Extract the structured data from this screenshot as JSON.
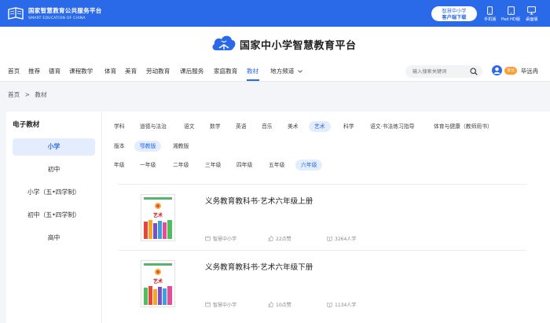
{
  "topbar": {
    "brand_cn": "国家智慧教育公共服务平台",
    "brand_en": "SMART EDUCATION OF CHINA",
    "download_line1": "智慧中小学",
    "download_line2": "客户端下载",
    "devices": [
      "手机版",
      "Pad HD版",
      "桌面版"
    ]
  },
  "header": {
    "title": "国家中小学智慧教育平台"
  },
  "nav": {
    "items": [
      "首页",
      "推荐",
      "德育",
      "课程教学",
      "体育",
      "美育",
      "劳动教育",
      "课后服务",
      "家庭教育",
      "教材",
      "地方频道"
    ],
    "active_index": 9,
    "search_placeholder": "输入搜索关键词",
    "role_badge": "家长",
    "user_name": "毕远冉"
  },
  "breadcrumb": {
    "home": "首页",
    "sep": ">",
    "current": "教材"
  },
  "sidebar": {
    "title": "电子教材",
    "items": [
      "小学",
      "初中",
      "小学（五•四学制）",
      "初中（五•四学制）",
      "高中"
    ],
    "active_index": 0
  },
  "filters": {
    "subject_label": "学科",
    "subjects": [
      "道德与法治",
      "语文",
      "数学",
      "英语",
      "音乐",
      "美术",
      "艺术",
      "科学",
      "语文·书法练习指导",
      "体育与健康（教师用书）"
    ],
    "subject_active": 6,
    "edition_label": "版本",
    "editions": [
      "鄂教版",
      "湘教版"
    ],
    "edition_active": 0,
    "grade_label": "年级",
    "grades": [
      "一年级",
      "二年级",
      "三年级",
      "四年级",
      "五年级",
      "六年级"
    ],
    "grade_active": 5
  },
  "books": [
    {
      "title": "义务教育教科书·艺术六年级上册",
      "cover_title": "艺术",
      "publisher": "智慧中小学",
      "likes": "22点赞",
      "learners": "3264人学"
    },
    {
      "title": "义务教育教科书·艺术六年级下册",
      "cover_title": "艺术",
      "publisher": "智慧中小学",
      "likes": "10点赞",
      "learners": "1134人学"
    }
  ],
  "colors": {
    "primary": "#2a6ae8",
    "active_bg": "#e4edfd",
    "badge": "#ff9b2f"
  }
}
